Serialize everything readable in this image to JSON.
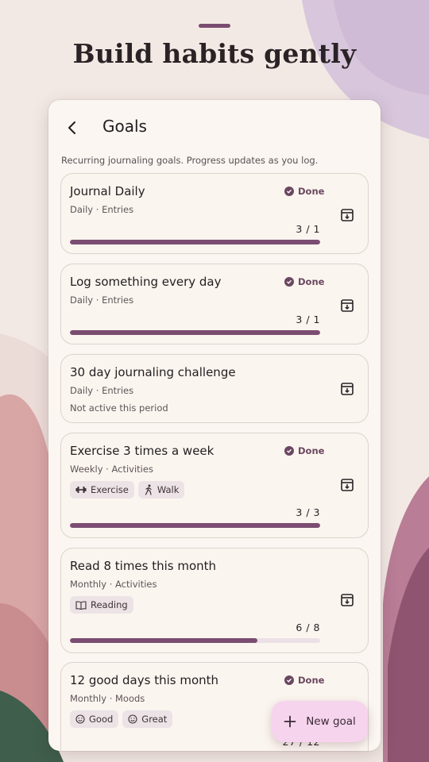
{
  "headline": "Build habits gently",
  "screen": {
    "title": "Goals",
    "subtitle": "Recurring journaling goals. Progress updates as you log."
  },
  "colors": {
    "accent": "#7b4d72",
    "fab": "#f7d4ee",
    "card_bg": "#fbf5ef",
    "track": "#ebe0e6"
  },
  "goals": [
    {
      "title": "Journal Daily",
      "meta": "Daily · Entries",
      "status": "Done",
      "count": "3 / 1",
      "progress": 1.0
    },
    {
      "title": "Log something every day",
      "meta": "Daily · Entries",
      "status": "Done",
      "count": "3 / 1",
      "progress": 1.0
    },
    {
      "title": "30 day journaling challenge",
      "meta": "Daily · Entries",
      "inactive_text": "Not active this period"
    },
    {
      "title": "Exercise 3 times a week",
      "meta": "Weekly · Activities",
      "status": "Done",
      "count": "3 / 3",
      "progress": 1.0,
      "chips": [
        {
          "label": "Exercise",
          "icon": "dumbbell-icon"
        },
        {
          "label": "Walk",
          "icon": "walk-icon"
        }
      ]
    },
    {
      "title": "Read 8 times this month",
      "meta": "Monthly · Activities",
      "count": "6 / 8",
      "progress": 0.75,
      "chips": [
        {
          "label": "Reading",
          "icon": "book-icon"
        }
      ]
    },
    {
      "title": "12 good days this month",
      "meta": "Monthly · Moods",
      "status": "Done",
      "count": "27 / 12",
      "chips": [
        {
          "label": "Good",
          "icon": "smile-icon"
        },
        {
          "label": "Great",
          "icon": "smile-icon"
        }
      ]
    }
  ],
  "fab": {
    "label": "New goal",
    "icon": "plus-icon"
  }
}
